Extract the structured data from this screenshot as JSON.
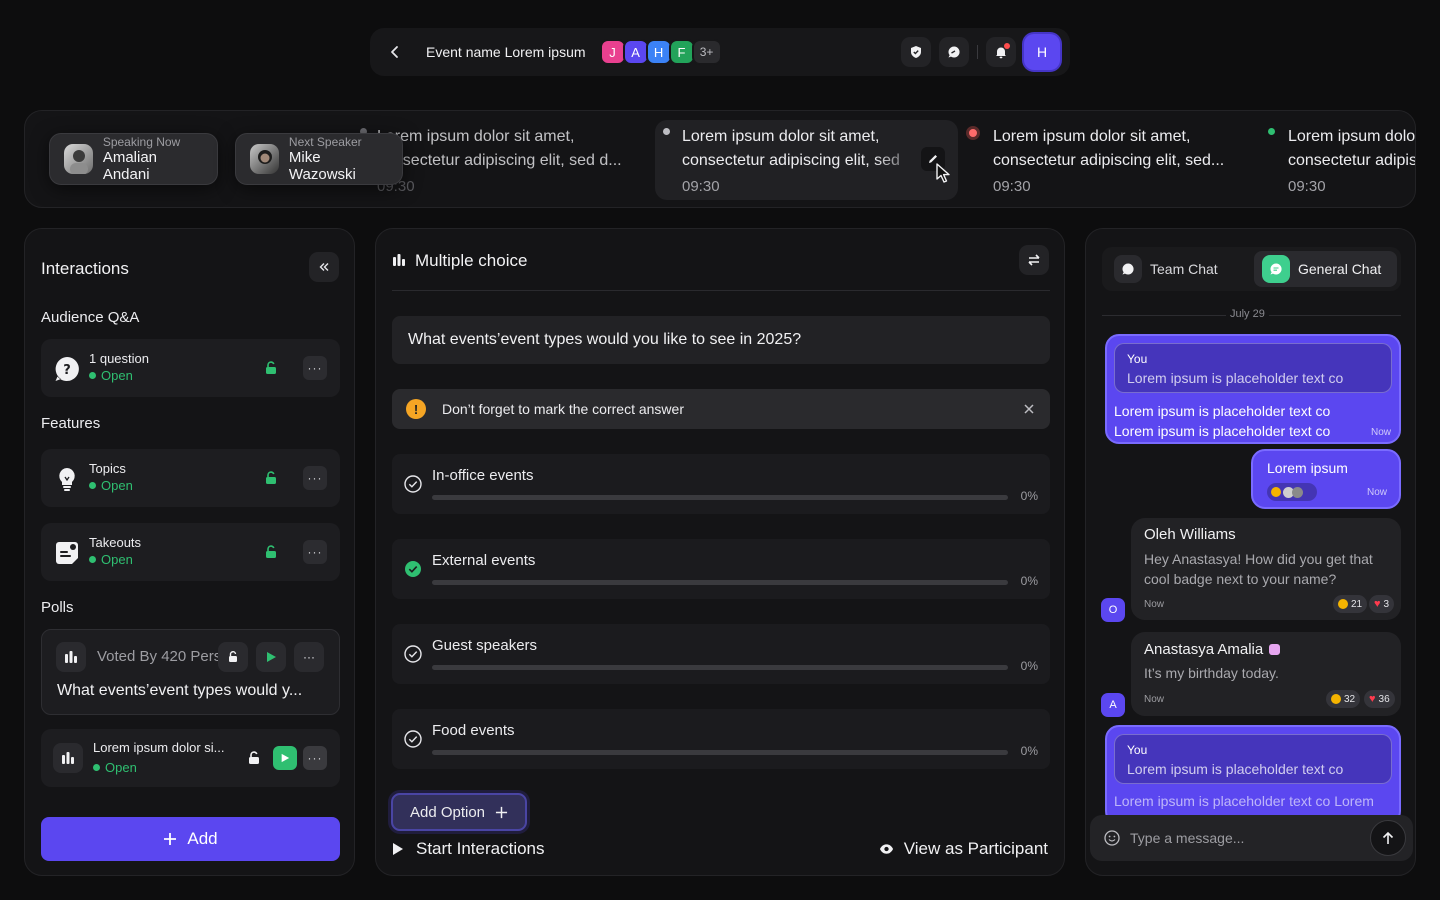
{
  "topbar": {
    "event_name": "Event name Lorem ipsum",
    "avatars": [
      {
        "letter": "J",
        "color": "#e9408f"
      },
      {
        "letter": "A",
        "color": "#5b47f0"
      },
      {
        "letter": "H",
        "color": "#3b82f6"
      },
      {
        "letter": "F",
        "color": "#22a35a"
      }
    ],
    "avatars_more": "3+",
    "user_initial": "H"
  },
  "ticker": {
    "items": [
      {
        "line1": "Lorem ipsum dolor sit amet,",
        "line2": "consectetur adipiscing elit, sed d...",
        "time": "09:30",
        "dot": "#6b6b70"
      },
      {
        "line1": "Lorem ipsum dolor sit amet,",
        "line2": "consectetur adipiscing elit, sed",
        "time": "09:30",
        "dot": "#bdbdc2"
      },
      {
        "line1": "Lorem ipsum dolor sit amet,",
        "line2": "consectetur adipiscing elit, sed...",
        "time": "09:30",
        "dot": "#ff4d4d"
      },
      {
        "line1": "Lorem ipsum dolor sit amet,",
        "line2": "consectetur adipiscing elit, sed...",
        "time": "09:30",
        "dot": "#2fbf71"
      }
    ],
    "speaking_now": {
      "label": "Speaking Now",
      "name": "Amalian Andani"
    },
    "next_speaker": {
      "label": "Next Speaker",
      "name": "Mike Wazowski"
    }
  },
  "interactions": {
    "title": "Interactions",
    "qa_label": "Audience Q&A",
    "qa_item": {
      "name": "1 question",
      "status": "Open"
    },
    "features_label": "Features",
    "features": [
      {
        "name": "Topics",
        "status": "Open"
      },
      {
        "name": "Takeouts",
        "status": "Open"
      }
    ],
    "polls_label": "Polls",
    "poll_expanded": {
      "voted": "Voted By 420 Pers",
      "question": "What events’event types would y..."
    },
    "poll_item": {
      "name": "Lorem ipsum dolor si...",
      "status": "Open"
    },
    "add_label": "Add"
  },
  "poll": {
    "header": "Multiple choice",
    "question": "What events’event types would you like to see in 2025?",
    "warning": "Don’t forget to mark the correct answer",
    "options": [
      {
        "label": "In-office events",
        "percent": "0%",
        "correct": false
      },
      {
        "label": "External events",
        "percent": "0%",
        "correct": true
      },
      {
        "label": "Guest speakers",
        "percent": "0%",
        "correct": false
      },
      {
        "label": "Food events",
        "percent": "0%",
        "correct": false
      }
    ],
    "add_option": "Add Option",
    "start": "Start Interactions",
    "view_participant": "View as Participant"
  },
  "chat": {
    "tab_team": "Team Chat",
    "tab_general": "General Chat",
    "date": "July 29",
    "messages": [
      {
        "quote_author": "You",
        "quote_text": "Lorem ipsum is placeholder text co",
        "text": "Lorem ipsum is placeholder text co Lorem ipsum is placeholder text co",
        "time": "Now"
      },
      {
        "text": "Lorem ipsum",
        "time": "Now"
      },
      {
        "author": "Oleh Williams",
        "avatar": "O",
        "text": "Hey Anastasya! How did you get that cool badge next to your name?",
        "time": "Now",
        "reactions": [
          "21",
          "3"
        ]
      },
      {
        "author": "Anastasya Amalia",
        "avatar": "A",
        "text": "It’s my birthday today.",
        "time": "Now",
        "reactions": [
          "32",
          "36"
        ]
      },
      {
        "quote_author": "You",
        "quote_text": "Lorem ipsum is placeholder text co",
        "text": "Lorem ipsum is placeholder text co Lorem"
      }
    ],
    "placeholder": "Type a message..."
  }
}
